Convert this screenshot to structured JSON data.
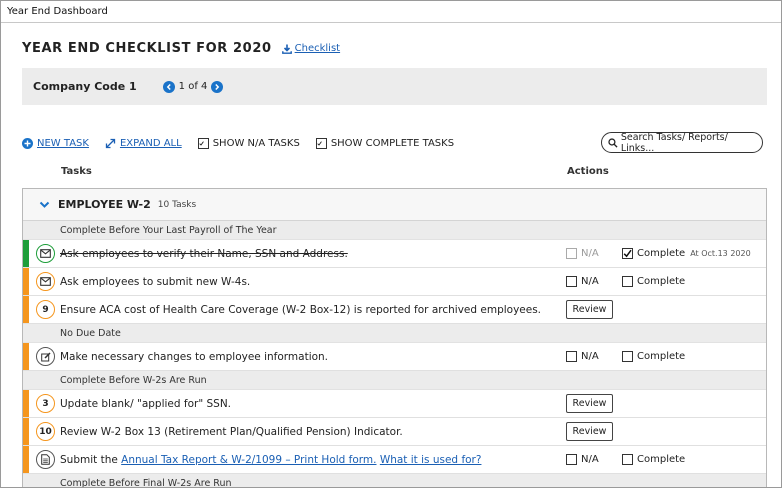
{
  "window": {
    "title": "Year End Dashboard"
  },
  "header": {
    "title": "YEAR END CHECKLIST FOR 2020",
    "checklist_link": "Checklist"
  },
  "company": {
    "label": "Company Code 1",
    "pager_text": "1 of 4"
  },
  "toolbar": {
    "new_task": "NEW TASK",
    "expand_all": "EXPAND ALL",
    "show_na": "SHOW N/A TASKS",
    "show_na_checked": true,
    "show_complete": "SHOW COMPLETE TASKS",
    "show_complete_checked": true,
    "search_placeholder": "Search Tasks/ Reports/ Links..."
  },
  "columns": {
    "tasks": "Tasks",
    "actions": "Actions"
  },
  "colors": {
    "complete": "#1e9e3a",
    "pending": "#f5961e",
    "link": "#1a5fb4",
    "pager": "#1a73c9"
  },
  "group": {
    "title": "EMPLOYEE W-2",
    "count": "10 Tasks"
  },
  "sections": [
    {
      "label": "Complete Before Your Last Payroll of The Year"
    },
    {
      "label": "No Due Date"
    },
    {
      "label": "Complete Before W-2s Are Run"
    },
    {
      "label": "Complete Before Final W-2s Are Run"
    }
  ],
  "tasks": [
    {
      "icon": "envelope-icon",
      "text": "Ask employees to verify their Name, SSN and Address.",
      "status": "complete",
      "na_label": "N/A",
      "complete_label": "Complete",
      "complete_date": "At Oct.13 2020"
    },
    {
      "icon": "envelope-icon",
      "text": "Ask employees to submit new W-4s.",
      "status": "pending",
      "na_label": "N/A",
      "complete_label": "Complete"
    },
    {
      "icon": "number-badge",
      "badge": "9",
      "text": "Ensure ACA cost of Health Care Coverage (W-2 Box-12) is reported for archived employees.",
      "status": "pending",
      "review_label": "Review"
    },
    {
      "icon": "edit-icon",
      "text": "Make necessary changes to employee information.",
      "status": "pending",
      "na_label": "N/A",
      "complete_label": "Complete"
    },
    {
      "icon": "number-badge",
      "badge": "3",
      "text": "Update blank/ \"applied for\" SSN.",
      "status": "pending",
      "review_label": "Review"
    },
    {
      "icon": "number-badge",
      "badge": "10",
      "text": "Review W-2 Box 13 (Retirement Plan/Qualified Pension) Indicator.",
      "status": "pending",
      "review_label": "Review"
    },
    {
      "icon": "document-icon",
      "text_prefix": "Submit the ",
      "link1": "Annual Tax Report & W-2/1099 – Print Hold form.",
      "link2": "What it is used for?",
      "status": "pending",
      "na_label": "N/A",
      "complete_label": "Complete"
    }
  ]
}
